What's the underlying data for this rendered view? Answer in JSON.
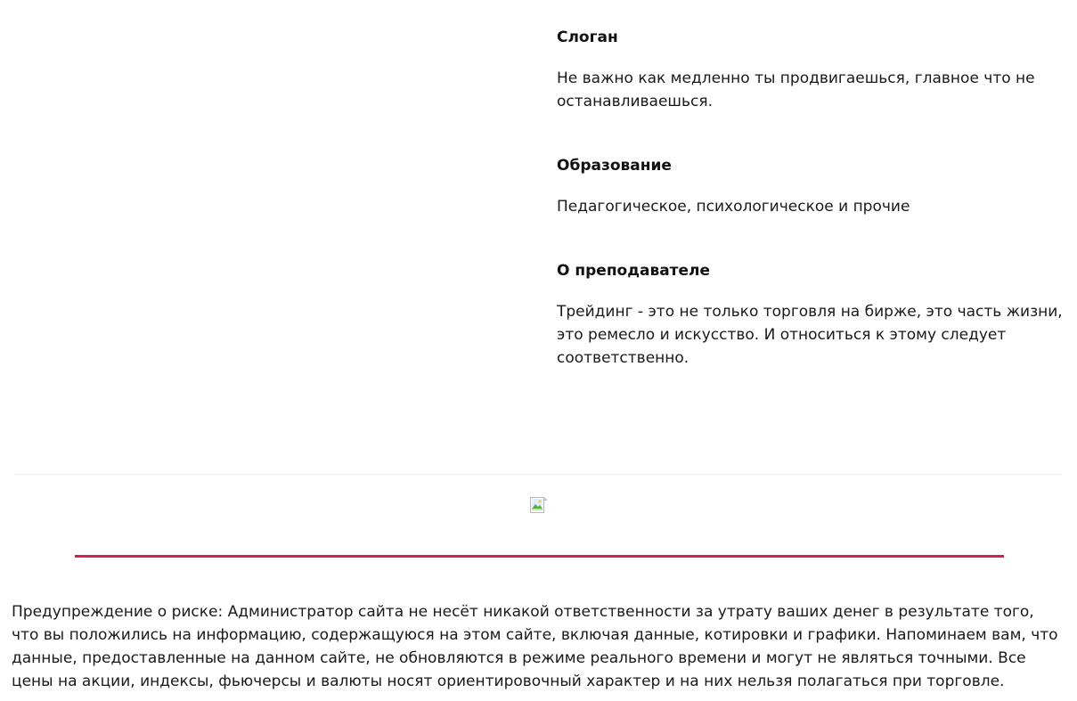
{
  "profile": {
    "sections": [
      {
        "title": "Слоган",
        "text": "Не важно как медленно ты продвигаешься, главное что не останавливаешься."
      },
      {
        "title": "Образование",
        "text": "Педагогическое, психологическое и прочие"
      },
      {
        "title": "О преподавателе",
        "text": "Трейдинг - это не только торговля на бирже, это часть жизни, это ремесло и искусство. И относиться к этому следует соответственно."
      }
    ]
  },
  "footer": {
    "image_icon": "broken-image-icon",
    "accent_color": "#dc1e4f",
    "risk_warning": "Предупреждение о риске: Администратор сайта не несёт никакой ответственности за утрату ваших денег в результате того, что вы положились на информацию, содержащуюся на этом сайте, включая данные, котировки и графики. Напоминаем вам, что данные, предоставленные на данном сайте, не обновляются в режиме реального времени и могут не являться точными. Все цены на акции, индексы, фьючерсы и валюты носят ориентировочный характер и на них нельзя полагаться при торговле."
  }
}
